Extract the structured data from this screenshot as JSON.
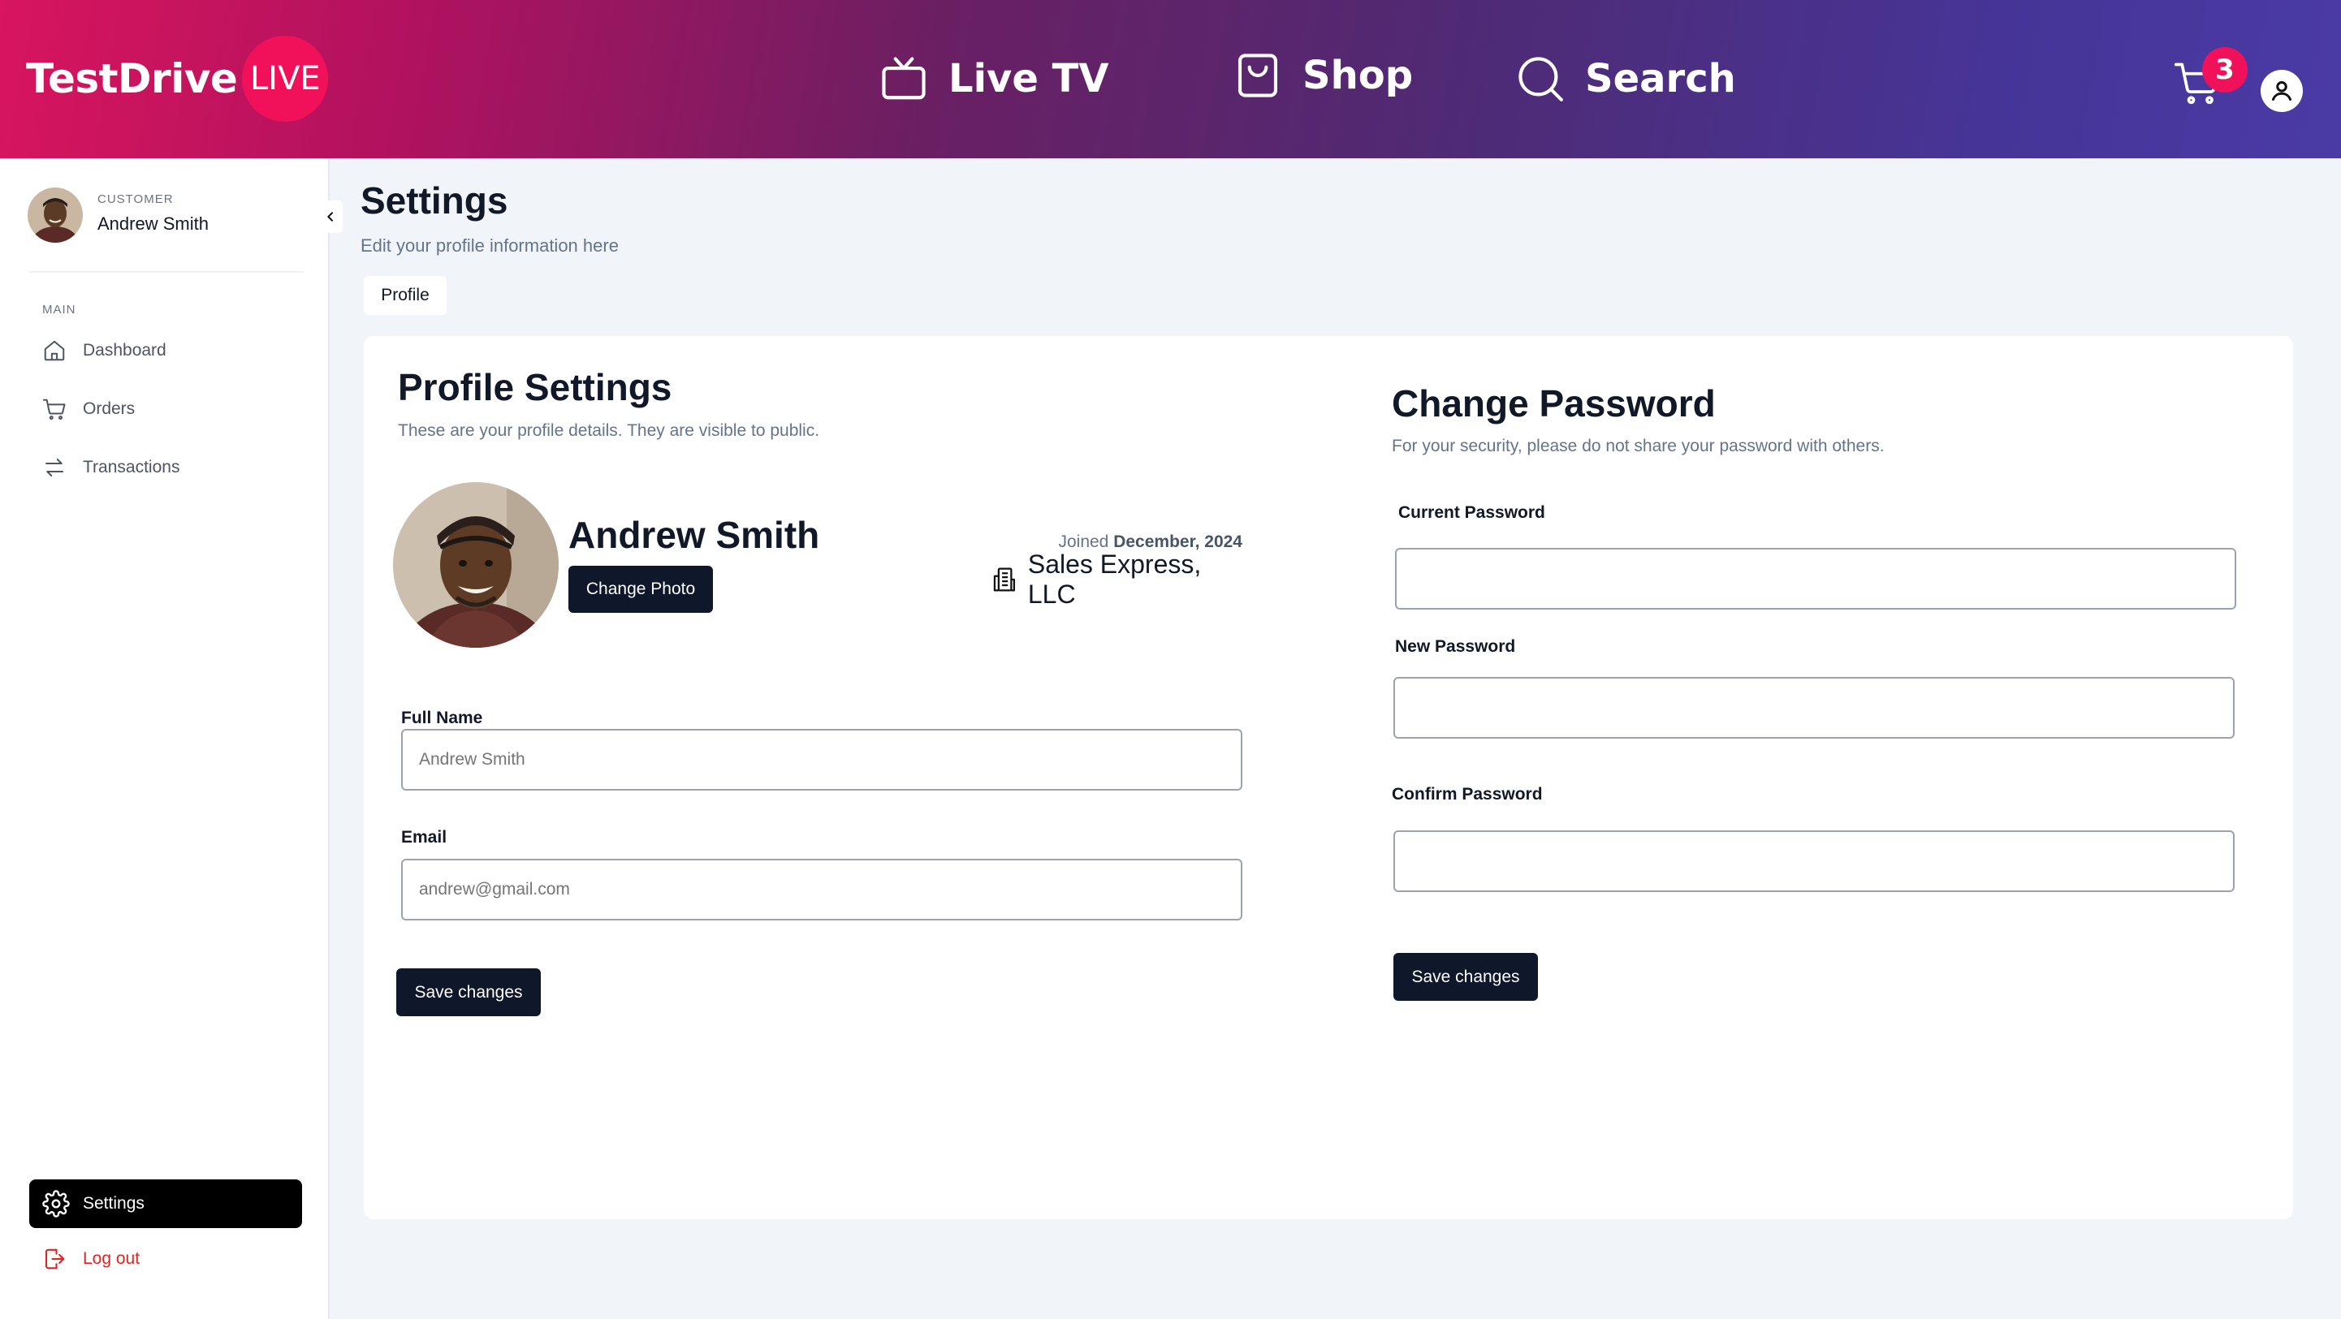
{
  "header": {
    "logo_text": "TestDrive",
    "logo_badge": "LIVE",
    "nav": {
      "live_tv": "Live TV",
      "shop": "Shop",
      "search": "Search"
    },
    "cart_count": "3"
  },
  "sidebar": {
    "user_role": "CUSTOMER",
    "user_name": "Andrew Smith",
    "section_main": "MAIN",
    "items": {
      "dashboard": "Dashboard",
      "orders": "Orders",
      "transactions": "Transactions"
    },
    "settings": "Settings",
    "logout": "Log out"
  },
  "page": {
    "title": "Settings",
    "subtitle": "Edit your profile information here",
    "tab_profile": "Profile"
  },
  "profile": {
    "title": "Profile Settings",
    "subtitle": "These are your profile details. They are visible to public.",
    "name": "Andrew Smith",
    "change_photo": "Change Photo",
    "joined_prefix": "Joined",
    "joined_date": "December, 2024",
    "company": "Sales Express, LLC",
    "full_name_label": "Full Name",
    "full_name_placeholder": "Andrew Smith",
    "email_label": "Email",
    "email_placeholder": "andrew@gmail.com",
    "save": "Save changes"
  },
  "password": {
    "title": "Change Password",
    "subtitle": "For your security, please do not share your password with others.",
    "current_label": "Current Password",
    "new_label": "New Password",
    "confirm_label": "Confirm Password",
    "save": "Save changes"
  },
  "colors": {
    "brand_pink": "#f0115a",
    "header_gradient_start": "#d8155e",
    "header_gradient_end": "#4a3aa5",
    "dark_button": "#0f172a",
    "logout_red": "#dc2626"
  }
}
